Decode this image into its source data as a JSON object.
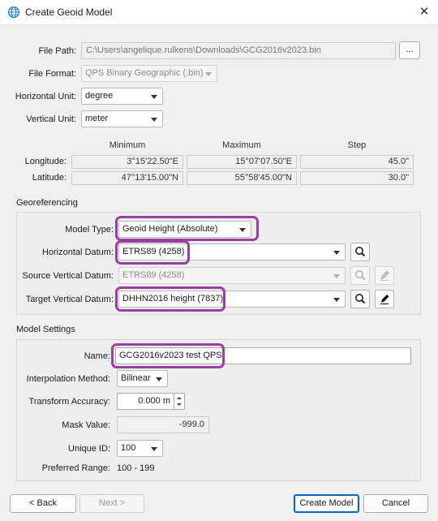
{
  "window": {
    "title": "Create Geoid Model",
    "icon": "globe-icon",
    "close_icon": "close-icon"
  },
  "file": {
    "path_label": "File Path:",
    "path_value": "C:\\Users\\angelique.rulkens\\Downloads\\GCG2016v2023.bin",
    "browse_label": "...",
    "format_label": "File Format:",
    "format_value": "QPS Binary Geographic (.bin)"
  },
  "units": {
    "horizontal_label": "Horizontal Unit:",
    "horizontal_value": "degree",
    "vertical_label": "Vertical Unit:",
    "vertical_value": "meter"
  },
  "ranges": {
    "headers": [
      "Minimum",
      "Maximum",
      "Step"
    ],
    "rows": [
      {
        "label": "Longitude:",
        "min": "3°15'22.50\"E",
        "max": "15°07'07.50\"E",
        "step": "45.0\""
      },
      {
        "label": "Latitude:",
        "min": "47°13'15.00\"N",
        "max": "55°58'45.00\"N",
        "step": "30.0\""
      }
    ]
  },
  "georef": {
    "title": "Georeferencing",
    "model_type_label": "Model Type:",
    "model_type_value": "Geoid Height (Absolute)",
    "h_datum_label": "Horizontal Datum:",
    "h_datum_value": "ETRS89 (4258)",
    "src_v_datum_label": "Source Vertical Datum:",
    "src_v_datum_value": "ETRS89 (4258)",
    "tgt_v_datum_label": "Target Vertical Datum:",
    "tgt_v_datum_value": "DHHN2016 height (7837)"
  },
  "model": {
    "title": "Model Settings",
    "name_label": "Name:",
    "name_value": "GCG2016v2023 test QPS",
    "interp_label": "Interpolation Method:",
    "interp_value": "Bilinear",
    "accuracy_label": "Transform Accuracy:",
    "accuracy_value": "0.000 m",
    "mask_label": "Mask Value:",
    "mask_value": "-999.0",
    "uid_label": "Unique ID:",
    "uid_value": "100",
    "pref_range_label": "Preferred Range:",
    "pref_range_value": "100 - 199"
  },
  "buttons": {
    "back": "< Back",
    "next": "Next >",
    "create": "Create Model",
    "cancel": "Cancel"
  },
  "colors": {
    "highlight": "#9b3ea3",
    "default_button": "#0067c0"
  }
}
